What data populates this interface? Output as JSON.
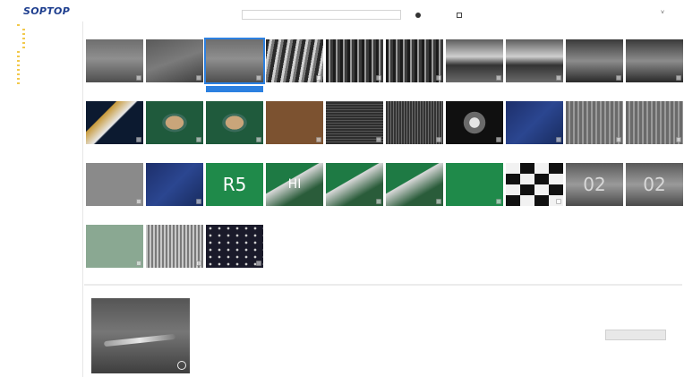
{
  "app": {
    "logo": "SOPTOP"
  },
  "toolbar": {
    "search_placeholder": "",
    "camera_label": "",
    "grid_label": "",
    "chevron": "˅"
  },
  "tree": {
    "items": [
      "",
      "",
      "",
      "",
      "",
      "",
      "",
      "",
      "",
      "",
      "",
      "",
      "",
      ""
    ]
  },
  "gallery": {
    "top_labels": [
      "",
      "",
      "",
      "",
      "",
      "",
      "",
      "",
      "",
      ""
    ],
    "row_labels": [
      [
        "",
        "",
        "",
        "",
        "",
        "",
        "",
        "",
        "",
        ""
      ],
      [
        "",
        "",
        "",
        "",
        "",
        "",
        "",
        "",
        "",
        ""
      ],
      [
        "",
        "",
        "",
        "",
        "",
        "",
        "",
        "",
        "",
        ""
      ],
      [
        "",
        "",
        ""
      ]
    ],
    "thumb_text": [
      "R5",
      "HI",
      "02",
      "02"
    ]
  },
  "details": {
    "labels_left": [
      "",
      "",
      "",
      "",
      "",
      ""
    ],
    "values_left": [
      "",
      "",
      "",
      "",
      "",
      ""
    ],
    "labels_right": [
      "",
      "",
      "",
      "",
      "",
      ""
    ],
    "values_right": [
      "",
      "",
      "",
      "",
      "",
      ""
    ],
    "path": "",
    "button_label": ""
  },
  "colors": {
    "brand": "#1f3f8f",
    "selection": "#2c80e0",
    "folder": "#f2c94c"
  },
  "icons": {
    "camera": "camera-icon",
    "grid": "grid-icon",
    "chevron": "chevron-down-icon",
    "folder": "folder-icon"
  }
}
